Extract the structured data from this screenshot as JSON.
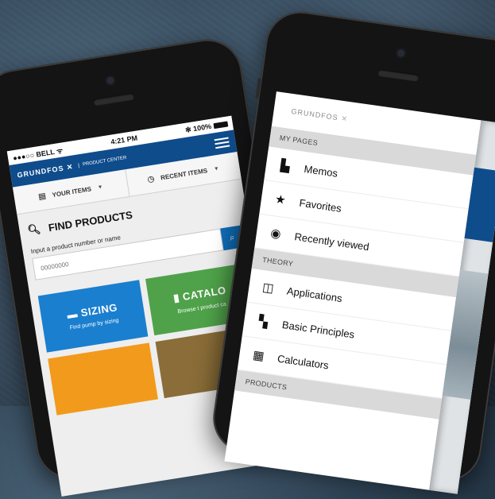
{
  "left_phone": {
    "status": {
      "carrier": "●●●○○ BELL ᯤ",
      "time": "4:21 PM",
      "battery": "✻ 100%"
    },
    "header": {
      "logo": "GRUNDFOS ✕",
      "subtitle": "PRODUCT CENTER"
    },
    "tabs": [
      {
        "label": "YOUR ITEMS",
        "icon": "list-icon"
      },
      {
        "label": "RECENT ITEMS",
        "icon": "clock-icon"
      }
    ],
    "find": {
      "title": "FIND PRODUCTS",
      "input_label": "Input a product number or name",
      "placeholder": "00000000"
    },
    "tiles": [
      {
        "title": "SIZING",
        "desc": "Find pump by sizing",
        "color": "#1a7fcf"
      },
      {
        "title": "CATALO",
        "desc": "Browse t product ca",
        "color": "#4fa24a"
      }
    ]
  },
  "right_phone": {
    "logo": "GRUNDFOS",
    "sections": [
      {
        "header": "MY PAGES",
        "items": [
          {
            "label": "Memos",
            "icon": "memo-icon"
          },
          {
            "label": "Favorites",
            "icon": "star-icon"
          },
          {
            "label": "Recently viewed",
            "icon": "eye-icon"
          }
        ]
      },
      {
        "header": "THEORY",
        "items": [
          {
            "label": "Applications",
            "icon": "applications-icon"
          },
          {
            "label": "Basic Principles",
            "icon": "principles-icon"
          },
          {
            "label": "Calculators",
            "icon": "calculator-icon"
          }
        ]
      },
      {
        "header": "PRODUCTS",
        "items": []
      }
    ]
  },
  "colors": {
    "brand_blue": "#0f4c8c",
    "sizing_blue": "#1a7fcf",
    "catalog_green": "#4fa24a"
  }
}
